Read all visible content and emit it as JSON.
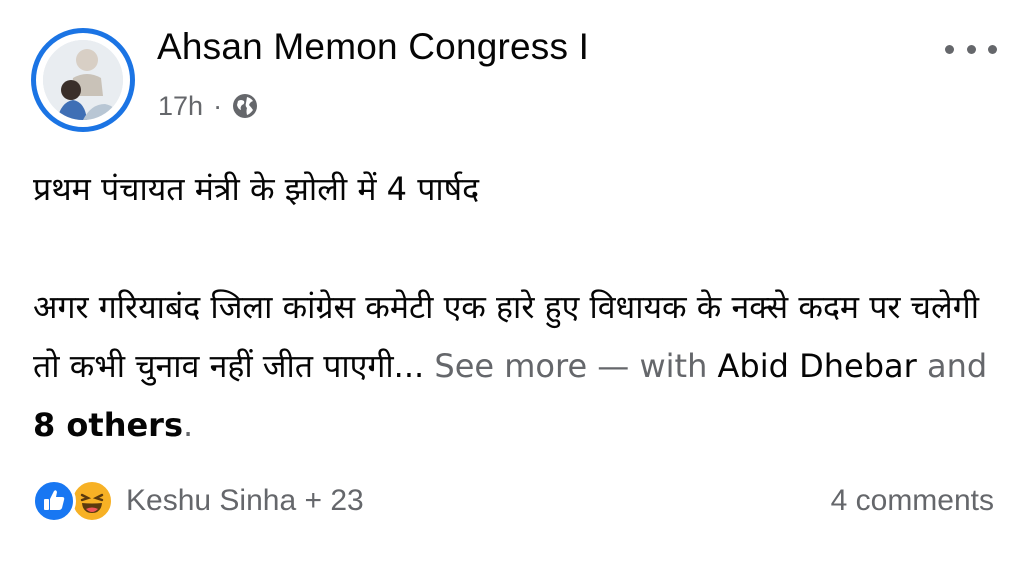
{
  "post": {
    "author": "Ahsan Memon Congress I",
    "time": "17h",
    "separator": "·",
    "audience_icon": "globe-icon",
    "more_icon": "more-dots-icon",
    "text_line1": "प्रथम पंचायत मंत्री के झोली में 4 पार्षद",
    "text_body": "अगर गरियाबंद जिला कांग्रेस कमेटी एक हारे हुए विधायक के नक्से कदम पर चलेगी तो कभी चुनाव नहीं जीत पाएगी...",
    "see_more": "See more",
    "with_prefix": "— with",
    "tagged_name": "Abid Dhebar",
    "and_text": "and",
    "others": "8 others",
    "period": "."
  },
  "footer": {
    "reaction_icons": [
      "like-icon",
      "haha-icon"
    ],
    "reactions_text": "Keshu Sinha + 23",
    "comments_text": "4 comments"
  },
  "colors": {
    "accent": "#1b74e4",
    "like_blue": "#1877f2",
    "haha_yellow": "#f7b125",
    "secondary_text": "#65676b",
    "primary_text": "#050505"
  }
}
